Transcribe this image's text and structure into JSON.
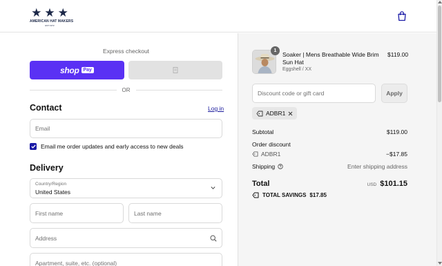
{
  "brand": {
    "name": "AMERICAN HAT MAKERS",
    "est": "EST 1972"
  },
  "express": {
    "title": "Express checkout",
    "shoppay_shop": "shop",
    "shoppay_pay": "Pay",
    "or": "OR"
  },
  "contact": {
    "title": "Contact",
    "login": "Log in",
    "email_placeholder": "Email",
    "marketing_label": "Email me order updates and early access to new deals",
    "marketing_checked": true
  },
  "delivery": {
    "title": "Delivery",
    "country_label": "Country/Region",
    "country_value": "United States",
    "first_name": "First name",
    "last_name": "Last name",
    "address": "Address",
    "apartment": "Apartment, suite, etc. (optional)"
  },
  "summary": {
    "item": {
      "quantity": "1",
      "title": "Soaker | Mens Breathable Wide Brim Sun Hat",
      "variant": "Eggshell / XX",
      "price": "$119.00"
    },
    "discount_placeholder": "Discount code or gift card",
    "apply": "Apply",
    "code": "ADBR1",
    "subtotal_label": "Subtotal",
    "subtotal_value": "$119.00",
    "order_discount_label": "Order discount",
    "discount_code": "ADBR1",
    "discount_value": "−$17.85",
    "shipping_label": "Shipping",
    "shipping_value": "Enter shipping address",
    "total_label": "Total",
    "total_currency": "USD",
    "total_value": "$101.15",
    "savings_label": "TOTAL SAVINGS",
    "savings_value": "$17.85"
  },
  "colors": {
    "shoppay": "#5a31f4",
    "brand_navy": "#1c2848",
    "checkbox": "#1a1aa6",
    "link": "#1a1a9c"
  }
}
